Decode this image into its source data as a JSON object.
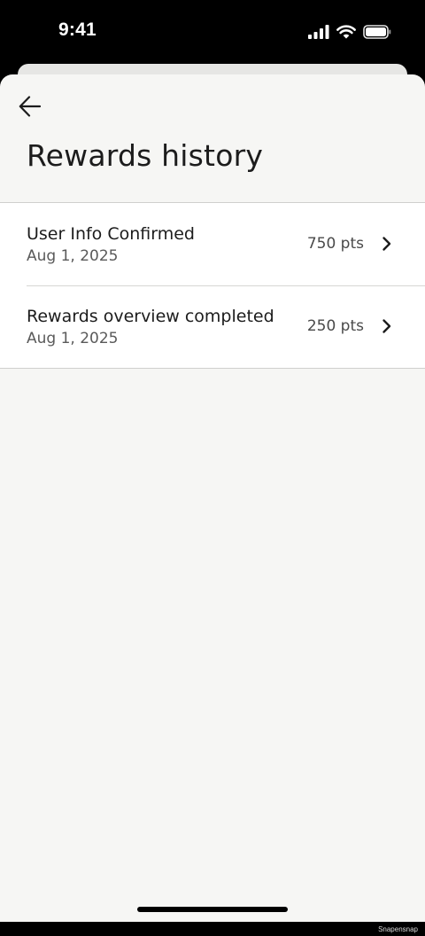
{
  "status_bar": {
    "time": "9:41",
    "icons": [
      "cellular-signal-icon",
      "wifi-icon",
      "battery-icon"
    ]
  },
  "header": {
    "back_icon": "arrow-left-icon",
    "title": "Rewards history"
  },
  "rewards": [
    {
      "title": "User Info Confirmed",
      "date": "Aug 1, 2025",
      "points": "750 pts",
      "icon": "chevron-right-icon"
    },
    {
      "title": "Rewards overview completed",
      "date": "Aug 1, 2025",
      "points": "250 pts",
      "icon": "chevron-right-icon"
    }
  ],
  "watermark": "Snapensnap",
  "colors": {
    "sheet_background": "#f6f6f4",
    "list_background": "#ffffff",
    "text_primary": "#1c1c1c",
    "text_secondary": "#5a5a5a",
    "divider": "#cfcfcd"
  }
}
